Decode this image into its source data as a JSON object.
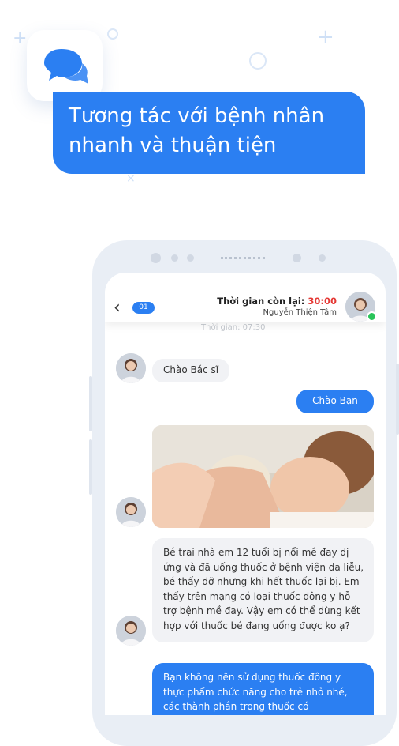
{
  "hero": {
    "line1": "Tương tác với bệnh nhân",
    "line2": "nhanh và thuận tiện"
  },
  "icons": {
    "app": "chat-bubbles-icon",
    "back": "chevron-left-icon"
  },
  "colors": {
    "accent": "#2b7ff2",
    "timer_red": "#e53935",
    "online": "#29c45a"
  },
  "chat_header": {
    "back_glyph": "‹",
    "unread_count": "01",
    "timer_label": "Thời gian còn lại: ",
    "timer_value": "30:00",
    "doctor_name": "Nguyễn Thiện Tâm"
  },
  "chat": {
    "time_hint": "Thời gian: 07:30",
    "msg1": "Chào Bác sĩ",
    "msg2": "Chào Bạn",
    "msg3": "Bé trai nhà em 12 tuổi bị nổi mề đay dị ứng và đã uống thuốc ở bệnh viện da liễu, bé thấy đỡ nhưng khi hết thuốc lại bị. Em thấy trên mạng có loại thuốc đông y hỗ trợ bệnh mề đay. Vậy em có thể dùng kết hợp với thuốc bé đang uống được ko ạ?",
    "msg4": "Bạn không nên sử dụng thuốc đông y thực phẩm chức năng cho trẻ nhỏ nhé, các thành phần trong thuốc có"
  }
}
